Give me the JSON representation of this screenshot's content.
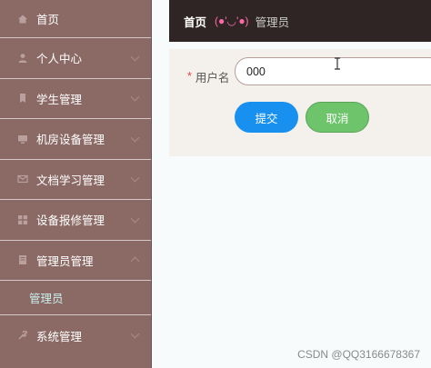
{
  "sidebar": {
    "items": [
      {
        "label": "首页",
        "icon": "home-icon"
      },
      {
        "label": "个人中心",
        "icon": "user-icon"
      },
      {
        "label": "学生管理",
        "icon": "student-icon"
      },
      {
        "label": "机房设备管理",
        "icon": "computer-icon"
      },
      {
        "label": "文档学习管理",
        "icon": "mail-icon"
      },
      {
        "label": "设备报修管理",
        "icon": "grid-icon"
      },
      {
        "label": "管理员管理",
        "icon": "document-icon"
      },
      {
        "label": "系统管理",
        "icon": "settings-icon"
      }
    ],
    "submenu": {
      "label": "管理员"
    }
  },
  "breadcrumb": {
    "home": "首页",
    "emoji": "(●'◡'●)",
    "current": "管理员"
  },
  "form": {
    "username_label": "用户名",
    "username_value": "000",
    "submit_label": "提交",
    "cancel_label": "取消"
  },
  "watermark": "CSDN @QQ3166678367",
  "colors": {
    "sidebar_bg": "#8b6a66",
    "header_bg": "#2f2524",
    "submit_blue": "#1890f0",
    "cancel_green": "#6ec46a",
    "submenu_text": "#c8f0ee"
  }
}
